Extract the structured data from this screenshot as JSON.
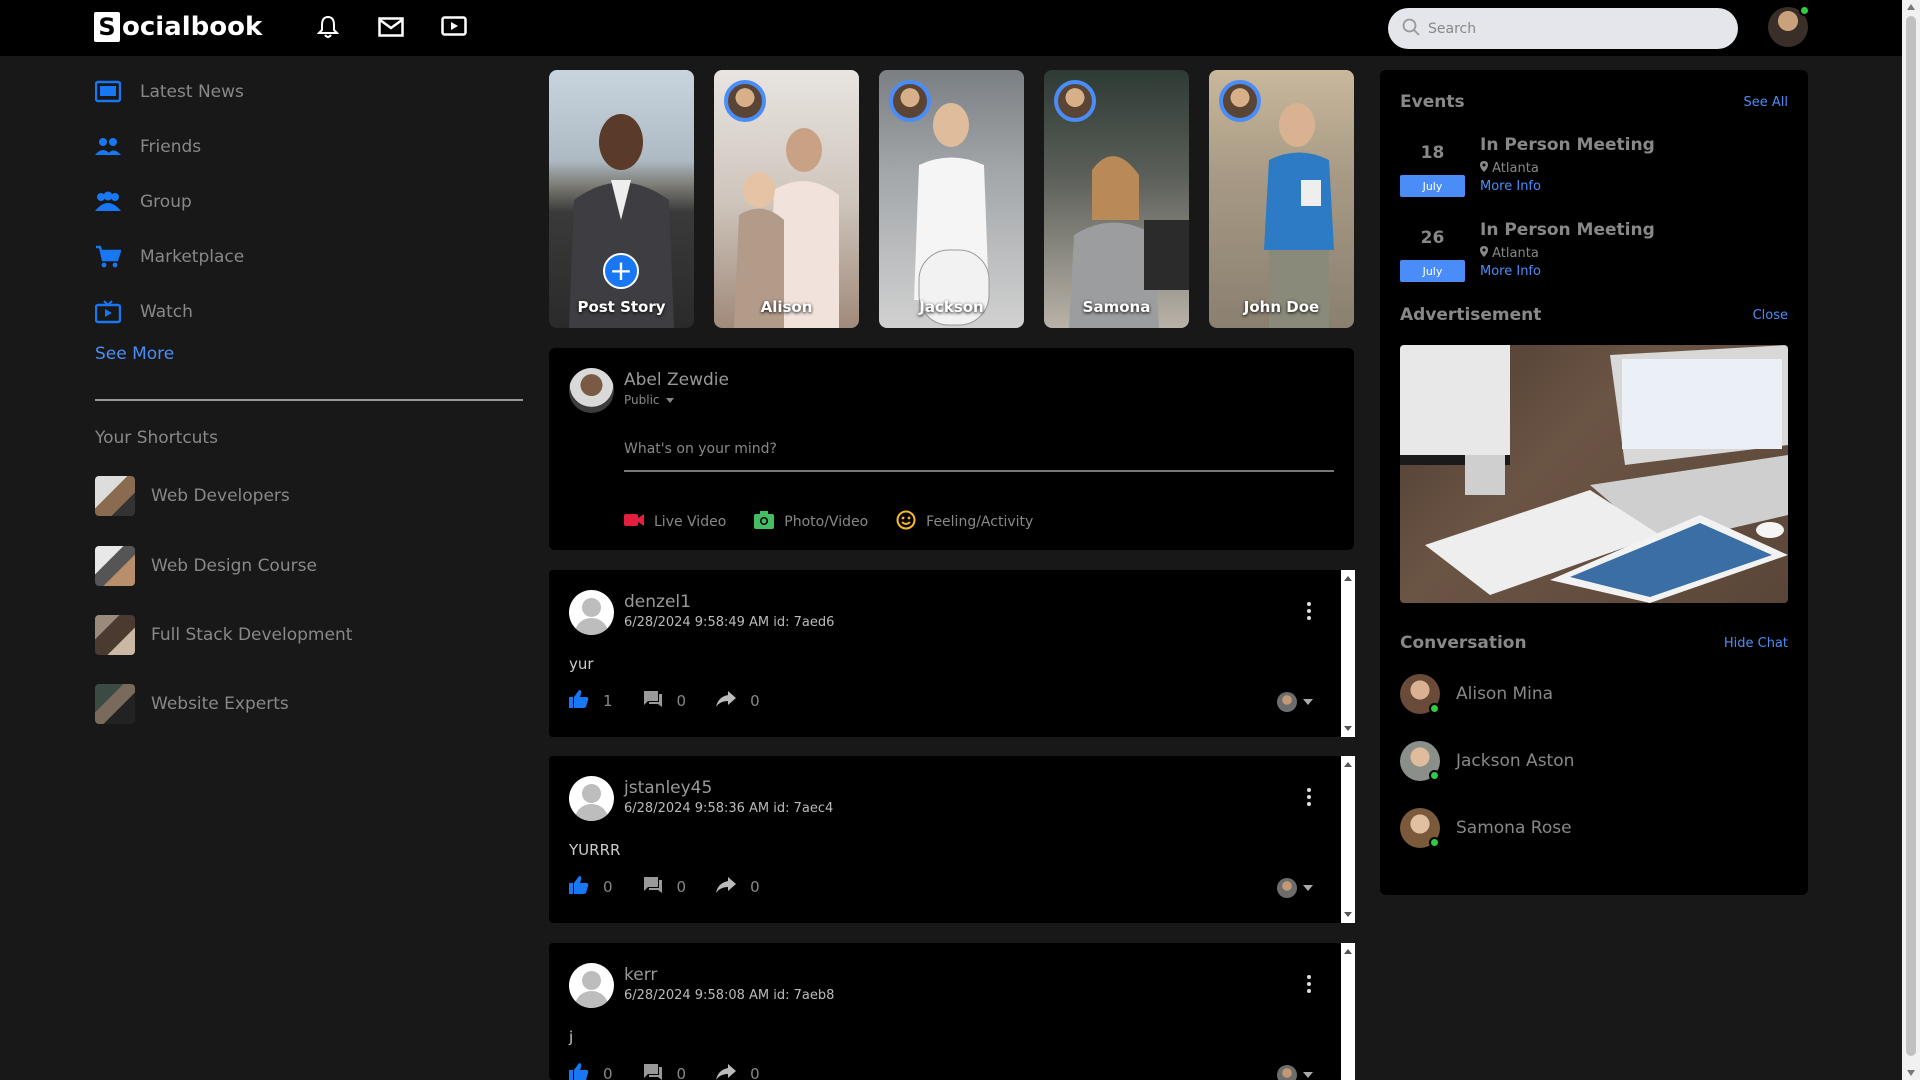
{
  "brand": {
    "name": "ocialbook",
    "initial": "S"
  },
  "search": {
    "placeholder": "Search"
  },
  "sidebar": {
    "items": [
      {
        "label": "Latest News"
      },
      {
        "label": "Friends"
      },
      {
        "label": "Group"
      },
      {
        "label": "Marketplace"
      },
      {
        "label": "Watch"
      }
    ],
    "see_more": "See More",
    "shortcuts_title": "Your Shortcuts",
    "shortcuts": [
      {
        "label": "Web Developers"
      },
      {
        "label": "Web Design Course"
      },
      {
        "label": "Full Stack Development"
      },
      {
        "label": "Website Experts"
      }
    ]
  },
  "stories": [
    {
      "label": "Post Story"
    },
    {
      "label": "Alison"
    },
    {
      "label": "Jackson"
    },
    {
      "label": "Samona"
    },
    {
      "label": "John Doe"
    }
  ],
  "create_post": {
    "user": "Abel Zewdie",
    "privacy": "Public",
    "placeholder": "What's on your mind?",
    "actions": [
      {
        "label": "Live Video",
        "icon": "video-camera-icon",
        "color": "#e41e3f"
      },
      {
        "label": "Photo/Video",
        "icon": "camera-icon",
        "color": "#45bd62"
      },
      {
        "label": "Feeling/Activity",
        "icon": "smiley-icon",
        "color": "#f7b928"
      }
    ]
  },
  "posts": [
    {
      "user": "denzel1",
      "meta": "6/28/2024 9:58:49 AM id: 7aed6",
      "text": "yur",
      "likes": "1",
      "comments": "0",
      "shares": "0"
    },
    {
      "user": "jstanley45",
      "meta": "6/28/2024 9:58:36 AM id: 7aec4",
      "text": "YURRR",
      "likes": "0",
      "comments": "0",
      "shares": "0"
    },
    {
      "user": "kerr",
      "meta": "6/28/2024 9:58:08 AM id: 7aeb8",
      "text": "j",
      "likes": "0",
      "comments": "0",
      "shares": "0"
    }
  ],
  "events": {
    "title": "Events",
    "see_all": "See All",
    "items": [
      {
        "day": "18",
        "month": "July",
        "title": "In Person Meeting",
        "location": "Atlanta",
        "more": "More Info"
      },
      {
        "day": "26",
        "month": "July",
        "title": "In Person Meeting",
        "location": "Atlanta",
        "more": "More Info"
      }
    ]
  },
  "advertisement": {
    "title": "Advertisement",
    "close": "Close"
  },
  "conversation": {
    "title": "Conversation",
    "hide": "Hide Chat",
    "contacts": [
      {
        "name": "Alison Mina"
      },
      {
        "name": "Jackson Aston"
      },
      {
        "name": "Samona Rose"
      }
    ]
  },
  "colors": {
    "accent": "#4b8df8",
    "like": "#1877f2",
    "online": "#2ecc40",
    "background": "#181818"
  }
}
